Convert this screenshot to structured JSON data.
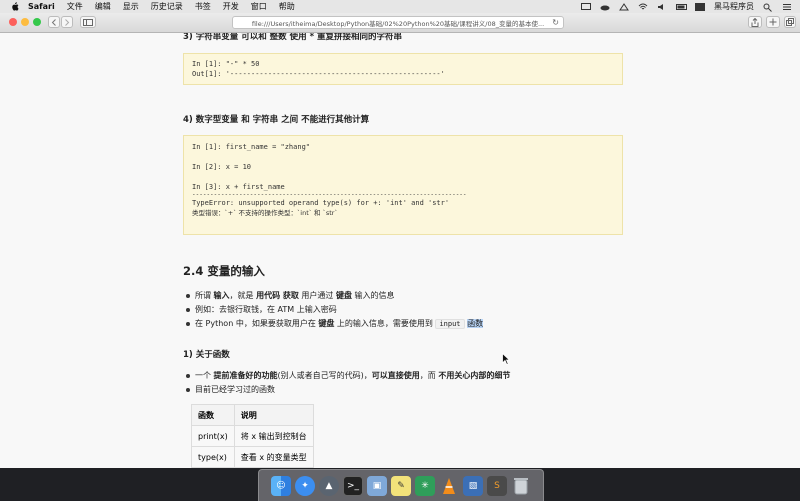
{
  "menubar": {
    "app": "Safari",
    "items": [
      "文件",
      "编辑",
      "显示",
      "历史记录",
      "书签",
      "开发",
      "窗口",
      "帮助"
    ],
    "right_label": "黑马程序员"
  },
  "browser": {
    "address": "file:///Users/itheima/Desktop/Python基础/02%20Python%20基础/课程讲义/08_变量的基本使..."
  },
  "doc": {
    "h3_repeat": "3) 字符串变量 可以和 整数 使用 * 重复拼接相同的字符串",
    "code1": [
      "In [1]: \"-\" * 50",
      "Out[1]: '--------------------------------------------------'"
    ],
    "h4_notcalc": "4) 数字型变量 和 字符串 之间 不能进行其他计算",
    "code2": {
      "line1": "In [1]: first_name = \"zhang\"",
      "line2": "In [2]: x = 10",
      "line3": "In [3]: x + first_name",
      "rule": "----------------------------------------------------------------------------",
      "err_en": "TypeError: unsupported operand type(s) for +: 'int' and 'str'",
      "err_cn": "类型错误：`+` 不支持的操作类型：`int` 和 `str`"
    },
    "section_title": "2.4 变量的输入",
    "bullets1": {
      "b1_pre": "所谓 ",
      "b1_k1": "输入",
      "b1_mid1": "，就是 ",
      "b1_k2": "用代码 获取",
      "b1_mid2": " 用户通过 ",
      "b1_k3": "键盘",
      "b1_post": " 输入的信息",
      "b2": "例如：去银行取钱，在 ATM 上输入密码",
      "b3_pre": "在 Python 中，如果要获取用户在 ",
      "b3_k": "键盘",
      "b3_mid": " 上的输入信息，需要使用到 ",
      "b3_code": "input",
      "b3_fn": "函数"
    },
    "h4_about": "1) 关于函数",
    "bullets2": {
      "c1_pre": "一个 ",
      "c1_k1": "提前准备好的功能",
      "c1_mid": "(别人或者自己写的代码)，",
      "c1_k2": "可以直接使用",
      "c1_mid2": "，而 ",
      "c1_k3": "不用关心内部的细节",
      "c2": "目前已经学习过的函数"
    },
    "table": {
      "headers": [
        "函数",
        "说明"
      ],
      "rows": [
        [
          "print(x)",
          "将 x 输出到控制台"
        ],
        [
          "type(x)",
          "查看 x 的变量类型"
        ]
      ]
    }
  },
  "colors": {
    "code_bg": "#fcf7dc",
    "highlight": "#b7d3f5",
    "close": "#fc605c",
    "minimize": "#fdbc40",
    "zoom": "#34c84a"
  },
  "dock_icons": [
    "finder-icon",
    "safari-icon",
    "rocket-icon",
    "terminal-icon",
    "preview-icon",
    "notes-icon",
    "xmind-icon",
    "vlc-icon",
    "photo-icon",
    "sublime-icon",
    "trash-icon"
  ]
}
